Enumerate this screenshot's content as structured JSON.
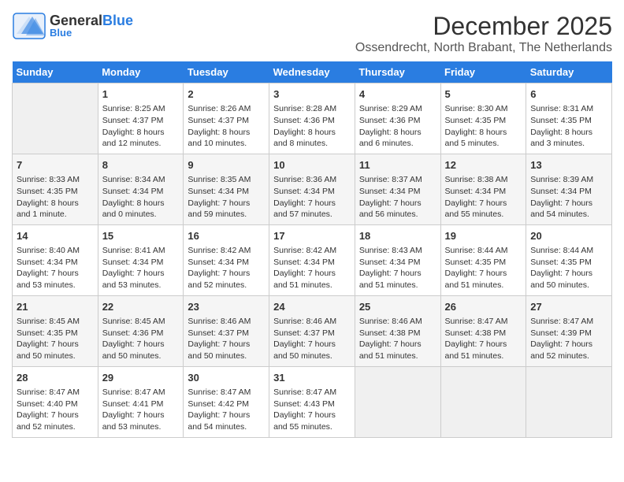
{
  "header": {
    "logo_general": "General",
    "logo_blue": "Blue",
    "month": "December 2025",
    "location": "Ossendrecht, North Brabant, The Netherlands"
  },
  "days_of_week": [
    "Sunday",
    "Monday",
    "Tuesday",
    "Wednesday",
    "Thursday",
    "Friday",
    "Saturday"
  ],
  "weeks": [
    [
      {
        "day": "",
        "empty": true
      },
      {
        "day": "1",
        "sunrise": "Sunrise: 8:25 AM",
        "sunset": "Sunset: 4:37 PM",
        "daylight": "Daylight: 8 hours and 12 minutes."
      },
      {
        "day": "2",
        "sunrise": "Sunrise: 8:26 AM",
        "sunset": "Sunset: 4:37 PM",
        "daylight": "Daylight: 8 hours and 10 minutes."
      },
      {
        "day": "3",
        "sunrise": "Sunrise: 8:28 AM",
        "sunset": "Sunset: 4:36 PM",
        "daylight": "Daylight: 8 hours and 8 minutes."
      },
      {
        "day": "4",
        "sunrise": "Sunrise: 8:29 AM",
        "sunset": "Sunset: 4:36 PM",
        "daylight": "Daylight: 8 hours and 6 minutes."
      },
      {
        "day": "5",
        "sunrise": "Sunrise: 8:30 AM",
        "sunset": "Sunset: 4:35 PM",
        "daylight": "Daylight: 8 hours and 5 minutes."
      },
      {
        "day": "6",
        "sunrise": "Sunrise: 8:31 AM",
        "sunset": "Sunset: 4:35 PM",
        "daylight": "Daylight: 8 hours and 3 minutes."
      }
    ],
    [
      {
        "day": "7",
        "sunrise": "Sunrise: 8:33 AM",
        "sunset": "Sunset: 4:35 PM",
        "daylight": "Daylight: 8 hours and 1 minute."
      },
      {
        "day": "8",
        "sunrise": "Sunrise: 8:34 AM",
        "sunset": "Sunset: 4:34 PM",
        "daylight": "Daylight: 8 hours and 0 minutes."
      },
      {
        "day": "9",
        "sunrise": "Sunrise: 8:35 AM",
        "sunset": "Sunset: 4:34 PM",
        "daylight": "Daylight: 7 hours and 59 minutes."
      },
      {
        "day": "10",
        "sunrise": "Sunrise: 8:36 AM",
        "sunset": "Sunset: 4:34 PM",
        "daylight": "Daylight: 7 hours and 57 minutes."
      },
      {
        "day": "11",
        "sunrise": "Sunrise: 8:37 AM",
        "sunset": "Sunset: 4:34 PM",
        "daylight": "Daylight: 7 hours and 56 minutes."
      },
      {
        "day": "12",
        "sunrise": "Sunrise: 8:38 AM",
        "sunset": "Sunset: 4:34 PM",
        "daylight": "Daylight: 7 hours and 55 minutes."
      },
      {
        "day": "13",
        "sunrise": "Sunrise: 8:39 AM",
        "sunset": "Sunset: 4:34 PM",
        "daylight": "Daylight: 7 hours and 54 minutes."
      }
    ],
    [
      {
        "day": "14",
        "sunrise": "Sunrise: 8:40 AM",
        "sunset": "Sunset: 4:34 PM",
        "daylight": "Daylight: 7 hours and 53 minutes."
      },
      {
        "day": "15",
        "sunrise": "Sunrise: 8:41 AM",
        "sunset": "Sunset: 4:34 PM",
        "daylight": "Daylight: 7 hours and 53 minutes."
      },
      {
        "day": "16",
        "sunrise": "Sunrise: 8:42 AM",
        "sunset": "Sunset: 4:34 PM",
        "daylight": "Daylight: 7 hours and 52 minutes."
      },
      {
        "day": "17",
        "sunrise": "Sunrise: 8:42 AM",
        "sunset": "Sunset: 4:34 PM",
        "daylight": "Daylight: 7 hours and 51 minutes."
      },
      {
        "day": "18",
        "sunrise": "Sunrise: 8:43 AM",
        "sunset": "Sunset: 4:34 PM",
        "daylight": "Daylight: 7 hours and 51 minutes."
      },
      {
        "day": "19",
        "sunrise": "Sunrise: 8:44 AM",
        "sunset": "Sunset: 4:35 PM",
        "daylight": "Daylight: 7 hours and 51 minutes."
      },
      {
        "day": "20",
        "sunrise": "Sunrise: 8:44 AM",
        "sunset": "Sunset: 4:35 PM",
        "daylight": "Daylight: 7 hours and 50 minutes."
      }
    ],
    [
      {
        "day": "21",
        "sunrise": "Sunrise: 8:45 AM",
        "sunset": "Sunset: 4:35 PM",
        "daylight": "Daylight: 7 hours and 50 minutes."
      },
      {
        "day": "22",
        "sunrise": "Sunrise: 8:45 AM",
        "sunset": "Sunset: 4:36 PM",
        "daylight": "Daylight: 7 hours and 50 minutes."
      },
      {
        "day": "23",
        "sunrise": "Sunrise: 8:46 AM",
        "sunset": "Sunset: 4:37 PM",
        "daylight": "Daylight: 7 hours and 50 minutes."
      },
      {
        "day": "24",
        "sunrise": "Sunrise: 8:46 AM",
        "sunset": "Sunset: 4:37 PM",
        "daylight": "Daylight: 7 hours and 50 minutes."
      },
      {
        "day": "25",
        "sunrise": "Sunrise: 8:46 AM",
        "sunset": "Sunset: 4:38 PM",
        "daylight": "Daylight: 7 hours and 51 minutes."
      },
      {
        "day": "26",
        "sunrise": "Sunrise: 8:47 AM",
        "sunset": "Sunset: 4:38 PM",
        "daylight": "Daylight: 7 hours and 51 minutes."
      },
      {
        "day": "27",
        "sunrise": "Sunrise: 8:47 AM",
        "sunset": "Sunset: 4:39 PM",
        "daylight": "Daylight: 7 hours and 52 minutes."
      }
    ],
    [
      {
        "day": "28",
        "sunrise": "Sunrise: 8:47 AM",
        "sunset": "Sunset: 4:40 PM",
        "daylight": "Daylight: 7 hours and 52 minutes."
      },
      {
        "day": "29",
        "sunrise": "Sunrise: 8:47 AM",
        "sunset": "Sunset: 4:41 PM",
        "daylight": "Daylight: 7 hours and 53 minutes."
      },
      {
        "day": "30",
        "sunrise": "Sunrise: 8:47 AM",
        "sunset": "Sunset: 4:42 PM",
        "daylight": "Daylight: 7 hours and 54 minutes."
      },
      {
        "day": "31",
        "sunrise": "Sunrise: 8:47 AM",
        "sunset": "Sunset: 4:43 PM",
        "daylight": "Daylight: 7 hours and 55 minutes."
      },
      {
        "day": "",
        "empty": true
      },
      {
        "day": "",
        "empty": true
      },
      {
        "day": "",
        "empty": true
      }
    ]
  ]
}
